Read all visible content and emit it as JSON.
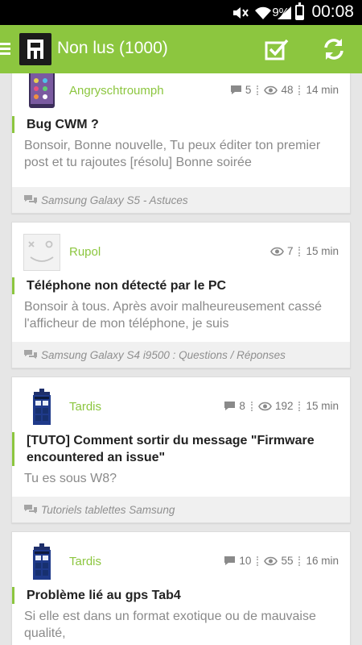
{
  "status_bar": {
    "battery_percent": "9%",
    "time": "00:08"
  },
  "app_bar": {
    "title": "Non lus (1000)"
  },
  "posts": [
    {
      "author": "Angryschtroumph",
      "comments": "5",
      "views": "48",
      "time": "14 min",
      "topic": "Bug CWM ?",
      "excerpt": "Bonsoir, Bonne nouvelle, Tu peux éditer ton premier post et tu rajoutes [résolu] Bonne soirée",
      "forum": "Samsung Galaxy S5 - Astuces"
    },
    {
      "author": "Rupol",
      "views": "7",
      "time": "15 min",
      "topic": "Téléphone non détecté par le PC",
      "excerpt": "Bonsoir à tous. Après avoir malheureusement cassé l'afficheur de mon téléphone, je suis",
      "forum": "Samsung Galaxy S4 i9500 : Questions / Réponses"
    },
    {
      "author": "Tardis",
      "comments": "8",
      "views": "192",
      "time": "15 min",
      "topic": "[TUTO] Comment sortir du message \"Firmware encountered an issue\"",
      "excerpt": "Tu es sous W8?",
      "forum": "Tutoriels tablettes Samsung"
    },
    {
      "author": "Tardis",
      "comments": "10",
      "views": "55",
      "time": "16 min",
      "topic": "Problème lié au gps Tab4",
      "excerpt": "Si elle est dans un format exotique ou de mauvaise qualité,",
      "forum": ""
    }
  ],
  "colors": {
    "accent": "#8cc63f",
    "background": "#e6e6e6"
  }
}
